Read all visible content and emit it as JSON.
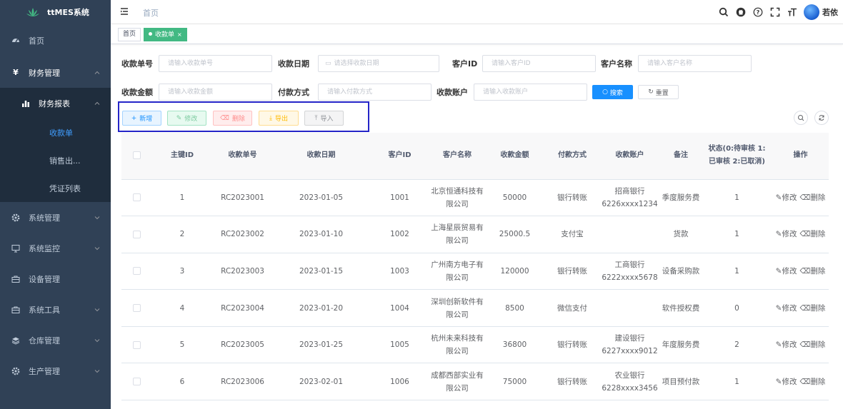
{
  "app": {
    "title": "ttMES系统",
    "user": "若依"
  },
  "sidebar": {
    "items": [
      {
        "label": "首页",
        "icon": "dashboard-icon"
      },
      {
        "label": "财务管理",
        "icon": "yen-icon"
      },
      {
        "label": "财务报表",
        "icon": "bar-chart-icon"
      },
      {
        "label": "收款单"
      },
      {
        "label": "销售出..."
      },
      {
        "label": "凭证列表"
      },
      {
        "label": "系统管理",
        "icon": "gear-icon"
      },
      {
        "label": "系统监控",
        "icon": "monitor-icon"
      },
      {
        "label": "设备管理",
        "icon": "toolbox-icon"
      },
      {
        "label": "系统工具",
        "icon": "toolbox-icon"
      },
      {
        "label": "仓库管理",
        "icon": "layers-icon"
      },
      {
        "label": "生产管理",
        "icon": "gear-icon"
      }
    ]
  },
  "header": {
    "breadcrumb": "首页"
  },
  "tags": [
    {
      "label": "首页"
    },
    {
      "label": "收款单",
      "close": "×"
    }
  ],
  "search": {
    "receipt_no": {
      "label": "收款单号",
      "placeholder": "请输入收款单号"
    },
    "receipt_date": {
      "label": "收款日期",
      "placeholder": "请选择收款日期"
    },
    "customer_id": {
      "label": "客户ID",
      "placeholder": "请输入客户ID"
    },
    "customer_name": {
      "label": "客户名称",
      "placeholder": "请输入客户名称"
    },
    "amount": {
      "label": "收款金额",
      "placeholder": "请输入收款金额"
    },
    "pay_method": {
      "label": "付款方式",
      "placeholder": "请输入付款方式"
    },
    "account": {
      "label": "收款账户",
      "placeholder": "请输入收款账户"
    },
    "search_btn": "搜索",
    "reset_btn": "重置"
  },
  "toolbar": {
    "add": "新增",
    "edit": "修改",
    "delete": "删除",
    "export": "导出",
    "import": "导入"
  },
  "table": {
    "headers": [
      "主键ID",
      "收款单号",
      "收款日期",
      "客户ID",
      "客户名称",
      "收款金额",
      "付款方式",
      "收款账户",
      "备注",
      "状态(0:待审核 1:已审核 2:已取消)",
      "操作"
    ],
    "op_edit": "修改",
    "op_delete": "删除",
    "rows": [
      [
        "1",
        "RC2023001",
        "2023-01-05",
        "1001",
        "北京恒通科技有限公司",
        "50000",
        "银行转账",
        "招商银行 6226xxxx1234",
        "季度服务费",
        "1"
      ],
      [
        "2",
        "RC2023002",
        "2023-01-10",
        "1002",
        "上海星辰贸易有限公司",
        "25000.5",
        "支付宝",
        "",
        "货款",
        "1"
      ],
      [
        "3",
        "RC2023003",
        "2023-01-15",
        "1003",
        "广州南方电子有限公司",
        "120000",
        "银行转账",
        "工商银行 6222xxxx5678",
        "设备采购款",
        "1"
      ],
      [
        "4",
        "RC2023004",
        "2023-01-20",
        "1004",
        "深圳创新软件有限公司",
        "8500",
        "微信支付",
        "",
        "软件授权费",
        "0"
      ],
      [
        "5",
        "RC2023005",
        "2023-01-25",
        "1005",
        "杭州未来科技有限公司",
        "36800",
        "银行转账",
        "建设银行 6227xxxx9012",
        "年度服务费",
        "2"
      ],
      [
        "6",
        "RC2023006",
        "2023-02-01",
        "1006",
        "成都西部实业有限公司",
        "75000",
        "银行转账",
        "农业银行 6228xxxx3456",
        "项目预付款",
        "1"
      ]
    ]
  }
}
